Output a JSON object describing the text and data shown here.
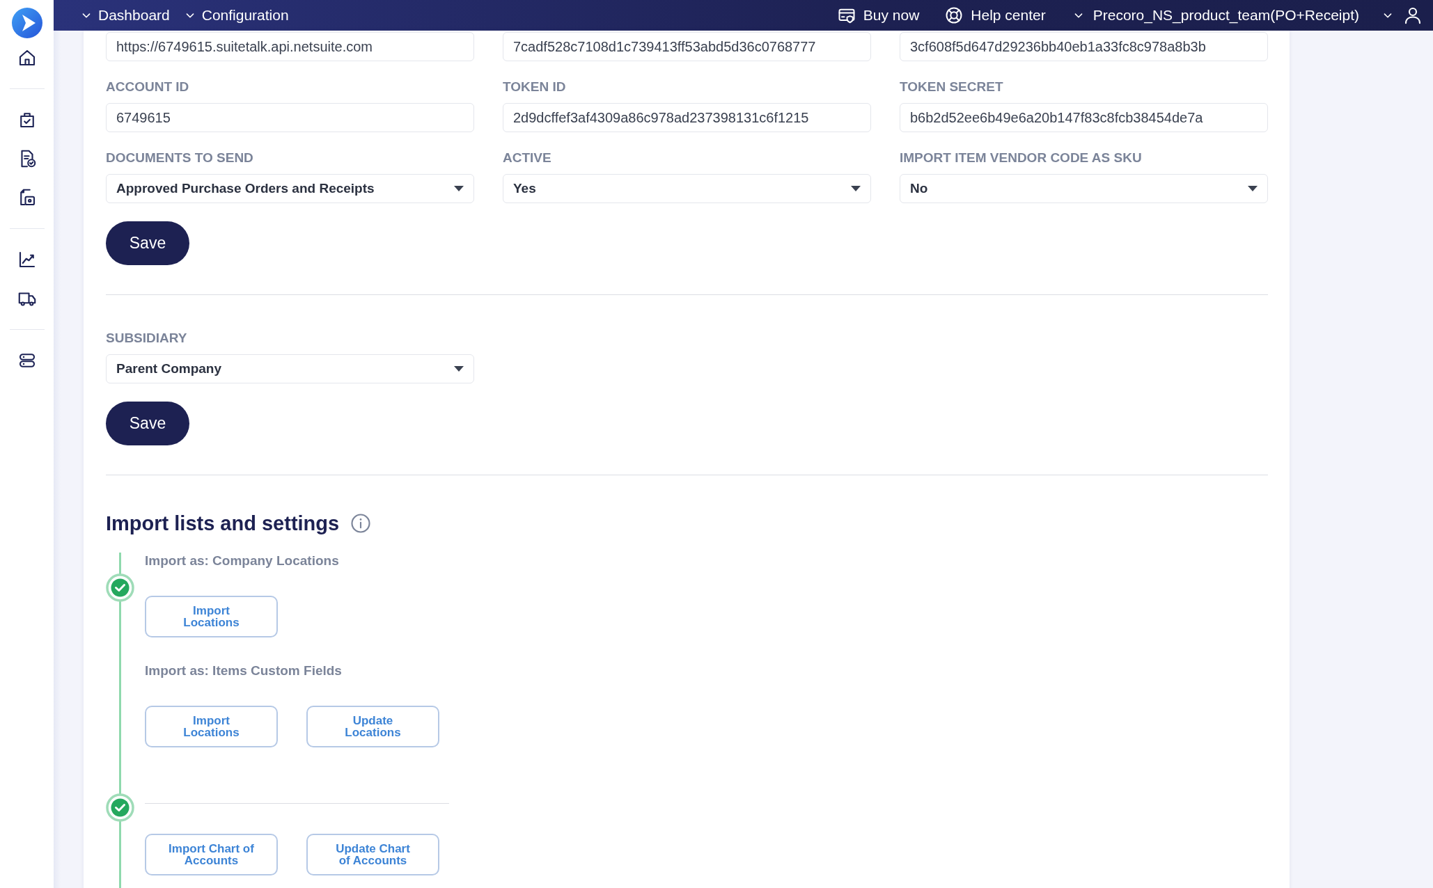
{
  "sidebar": {
    "items": [
      {
        "kind": "logo"
      },
      {
        "kind": "home"
      },
      {
        "kind": "divider"
      },
      {
        "kind": "bag"
      },
      {
        "kind": "doc-check"
      },
      {
        "kind": "doc-lock"
      },
      {
        "kind": "divider"
      },
      {
        "kind": "chart"
      },
      {
        "kind": "truck"
      },
      {
        "kind": "divider"
      },
      {
        "kind": "toggles"
      }
    ]
  },
  "header": {
    "nav": [
      {
        "label": "Dashboard"
      },
      {
        "label": "Configuration"
      }
    ],
    "actions": [
      {
        "kind": "card",
        "label": "Buy now"
      },
      {
        "kind": "help",
        "label": "Help center"
      }
    ],
    "account": "Precoro_NS_product_team(PO+Receipt)"
  },
  "sections": [
    {
      "rows": [
        [
          {
            "kind": "input",
            "value": "https://6749615.suitetalk.api.netsuite.com"
          },
          {
            "kind": "input",
            "value": "7cadf528c7108d1c739413ff53abd5d36c0768777"
          },
          {
            "kind": "input",
            "value": "3cf608f5d647d29236bb40eb1a33fc8c978a8b3b"
          }
        ],
        [
          {
            "kind": "input",
            "label": "ACCOUNT ID",
            "value": "6749615"
          },
          {
            "kind": "input",
            "label": "TOKEN ID",
            "value": "2d9dcffef3af4309a86c978ad237398131c6f1215"
          },
          {
            "kind": "input",
            "label": "TOKEN SECRET",
            "value": "b6b2d52ee6b49e6a20b147f83c8fcb38454de7a"
          }
        ],
        [
          {
            "kind": "select",
            "label": "DOCUMENTS TO SEND",
            "value": "Approved Purchase Orders and Receipts"
          },
          {
            "kind": "select",
            "label": "ACTIVE",
            "value": "Yes"
          },
          {
            "kind": "select",
            "label": "IMPORT ITEM VENDOR CODE AS SKU",
            "value": "No"
          }
        ]
      ],
      "button": "Save"
    },
    {
      "rows": [
        [
          {
            "kind": "select",
            "label": "SUBSIDIARY",
            "value": "Parent Company"
          }
        ]
      ],
      "button": "Save"
    }
  ],
  "import": {
    "title": "Import lists and settings",
    "steps": [
      {
        "done": true,
        "groups": [
          {
            "caption": "Import as: Company Locations",
            "buttons": [
              "Import Locations"
            ]
          },
          {
            "caption": "Import as: Items Custom Fields",
            "buttons": [
              "Import Locations",
              "Update Locations"
            ]
          }
        ]
      },
      {
        "done": true,
        "groups": [
          {
            "buttons": [
              "Import Chart of Accounts",
              "Update Chart of Accounts"
            ]
          }
        ]
      }
    ]
  }
}
